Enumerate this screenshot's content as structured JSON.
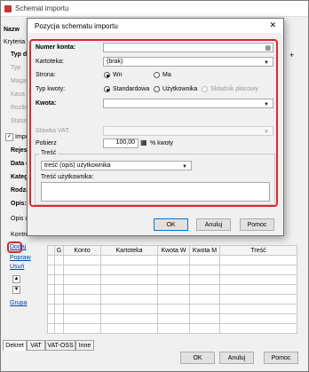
{
  "outer": {
    "title": "Schemat importu",
    "labels": {
      "nazwa": "Nazw",
      "kryteria": "Kryteria",
      "typ_d": "Typ d",
      "typ2": "Typ",
      "maga": "Maga",
      "kasa": "Kasa",
      "rozlic": "Rozlic",
      "status": "Status",
      "import_check": "Impo",
      "rejest": "Rejest",
      "data_c": "Data c",
      "kateg": "Kateg",
      "rodza": "Rodza",
      "opis": "Opis:",
      "opis_u": "Opis u",
      "kontro": "Kontro"
    },
    "links": {
      "dodaj": "Dodaj",
      "popraw": "Popraw",
      "usun": "Usuń",
      "grupa": "Grupa"
    },
    "grid_headers": [
      "G",
      "Konto",
      "Kartoteka",
      "Kwota W",
      "Kwota M",
      "Treść"
    ],
    "tabs": [
      "Dekret",
      "VAT",
      "VAT-OSS",
      "Inne"
    ],
    "buttons": {
      "ok": "OK",
      "anuluj": "Anuluj",
      "pomoc": "Pomoc"
    }
  },
  "dialog": {
    "title": "Pozycja schematu importu",
    "numer_konta_label": "Numer konta:",
    "kartoteka_label": "Kartoteka:",
    "kartoteka_value": "(brak)",
    "strona_label": "Strona:",
    "strona_opt1": "Wn",
    "strona_opt2": "Ma",
    "typ_kwoty_label": "Typ kwoty:",
    "typ_opt1": "Standardowa",
    "typ_opt2": "Użytkownika",
    "typ_opt3": "Składnik płacowy",
    "kwota_label": "Kwota:",
    "stawka_vat_label": "Stawka VAT:",
    "pobierz_label": "Pobierz",
    "pobierz_value": "100,00",
    "pobierz_unit": "% kwoty",
    "tresc_group": "Treść",
    "tresc_value": "treść (opis) użytkownika",
    "tresc_uzytk_label": "Treść użytkownika:",
    "buttons": {
      "ok": "OK",
      "anuluj": "Anuluj",
      "pomoc": "Pomoc"
    }
  }
}
